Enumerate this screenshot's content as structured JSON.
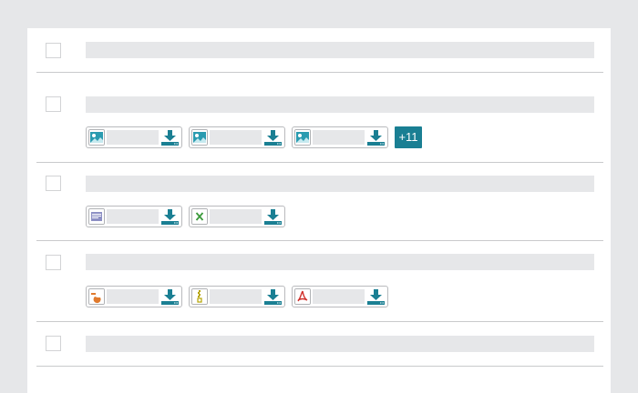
{
  "colors": {
    "background": "#e6e7e9",
    "panel": "#ffffff",
    "placeholder": "#e6e7e9",
    "accent": "#1a7f93",
    "divider": "#c9cacc"
  },
  "rows": [
    {
      "checkbox_checked": false,
      "attachments": []
    },
    {
      "checkbox_checked": false,
      "attachments": [
        {
          "icon": "image-file-icon"
        },
        {
          "icon": "image-file-icon"
        },
        {
          "icon": "image-file-icon"
        }
      ],
      "more_label": "+11"
    },
    {
      "checkbox_checked": false,
      "attachments": [
        {
          "icon": "document-file-icon"
        },
        {
          "icon": "excel-file-icon"
        }
      ]
    },
    {
      "checkbox_checked": false,
      "attachments": [
        {
          "icon": "presentation-file-icon"
        },
        {
          "icon": "zip-file-icon"
        },
        {
          "icon": "pdf-file-icon"
        }
      ]
    },
    {
      "checkbox_checked": false,
      "attachments": []
    }
  ],
  "icons": {
    "download": "download-icon"
  }
}
